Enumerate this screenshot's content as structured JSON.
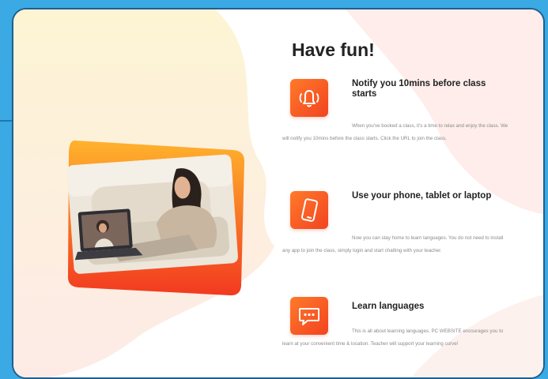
{
  "page": {
    "heading": "Have fun!",
    "accent_color": "#f4511e",
    "background_color": "#3ba9e3"
  },
  "hero_image": {
    "icon": "woman-on-sofa-with-laptop-photo"
  },
  "features": [
    {
      "icon": "bell-ringing-icon",
      "title": "Notify you 10mins before class starts",
      "text": "When you've booked a class, it's a time to relax and enjoy the class. We will notify you 10mins before the class starts. Click the URL to join the class."
    },
    {
      "icon": "phone-icon",
      "title": "Use your phone, tablet or laptop",
      "text": "Now you can stay home to learn languages. You do not need to install any app to join the class, simply login and start chatting with your teacher."
    },
    {
      "icon": "chat-bubble-icon",
      "title": "Learn languages",
      "text": "This is all about learning languages. PC WEBSITE encourages you to learn at your convenient time & location. Teacher will support your learning curve!"
    }
  ]
}
